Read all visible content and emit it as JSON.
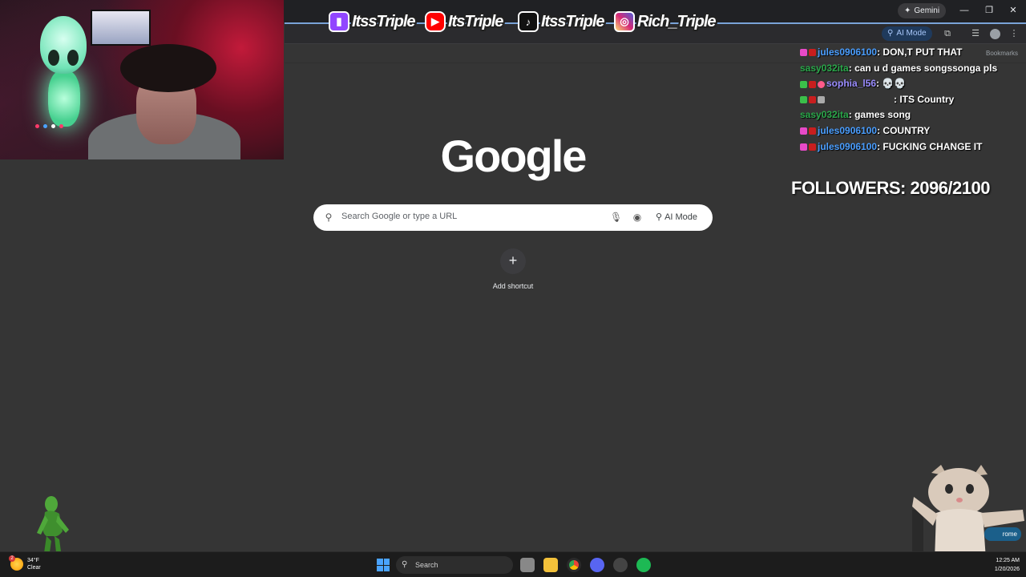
{
  "browser": {
    "gemini_label": "Gemini",
    "ai_mode_chip": "AI Mode",
    "bookmarks_label": "Bookmarks",
    "window_controls": [
      "—",
      "❐",
      "✕"
    ]
  },
  "social_banner": [
    {
      "platform": "twitch",
      "icon": "twitch-icon",
      "handle": "ItssTriple",
      "color": "#9146ff"
    },
    {
      "platform": "youtube",
      "icon": "youtube-icon",
      "handle": "ItsTriple",
      "color": "#ff0000"
    },
    {
      "platform": "tiktok",
      "icon": "tiktok-icon",
      "handle": "ItssTriple",
      "color": "#111111"
    },
    {
      "platform": "instagram",
      "icon": "instagram-icon",
      "handle": "Rich_Triple",
      "color": "#d62976"
    }
  ],
  "google": {
    "logo_text": "Google",
    "search_placeholder": "Search Google or type a URL",
    "ai_mode_label": "AI Mode",
    "add_shortcut_label": "Add shortcut"
  },
  "chat": [
    {
      "user": "jules0906100",
      "user_color": "#4a9eff",
      "message": "DON,T PUT THAT"
    },
    {
      "user": "sasy032ita",
      "user_color": "#2aa84a",
      "message": "can u d games songssonga pls"
    },
    {
      "user": "sophia_l56",
      "user_color": "#9a8cff",
      "message": "💀💀"
    },
    {
      "user": "",
      "user_color": "#c81e1e",
      "message": "ITS Country"
    },
    {
      "user": "sasy032ita",
      "user_color": "#2aa84a",
      "message": "games song"
    },
    {
      "user": "jules0906100",
      "user_color": "#4a9eff",
      "message": "COUNTRY"
    },
    {
      "user": "jules0906100",
      "user_color": "#4a9eff",
      "message": "FUCKING CHANGE IT"
    }
  ],
  "followers": {
    "label": "FOLLOWERS: 2096/2100",
    "current": 2096,
    "goal": 2100
  },
  "taskbar": {
    "weather_temp": "34°F",
    "weather_desc": "Clear",
    "weather_badge": "2",
    "search_label": "Search",
    "time": "12:25 AM",
    "date": "1/20/2026",
    "chrome_chip": "rome",
    "apps": [
      {
        "name": "file-manager-icon",
        "color": "#888888"
      },
      {
        "name": "file-explorer-icon",
        "color": "#f3c13a"
      },
      {
        "name": "chrome-icon",
        "color": "#2f9e44"
      },
      {
        "name": "discord-icon",
        "color": "#5865f2"
      },
      {
        "name": "steam-icon",
        "color": "#444444"
      },
      {
        "name": "spotify-icon",
        "color": "#1db954"
      }
    ]
  }
}
